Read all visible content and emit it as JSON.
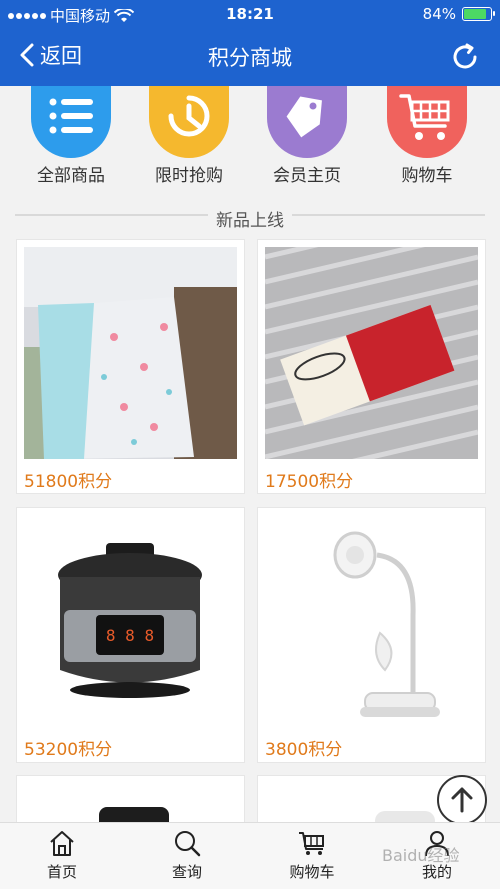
{
  "status_bar": {
    "carrier": "中国移动",
    "time": "18:21",
    "battery": "84%",
    "battery_level": 0.84
  },
  "nav": {
    "back_label": "返回",
    "title": "积分商城",
    "refresh_icon": "refresh-icon",
    "color": "#1e63cf"
  },
  "categories": [
    {
      "label": "全部商品",
      "icon": "list-icon",
      "color": "#2d9cec"
    },
    {
      "label": "限时抢购",
      "icon": "clock-icon",
      "color": "#f5b82e"
    },
    {
      "label": "会员主页",
      "icon": "tag-icon",
      "color": "#9b7bd0"
    },
    {
      "label": "购物车",
      "icon": "cart-icon",
      "color": "#f0625d"
    }
  ],
  "section": {
    "title": "新品上线"
  },
  "products": [
    {
      "price": "51800积分",
      "image": "blanket-photo"
    },
    {
      "price": "17500积分",
      "image": "cotton-label-photo"
    },
    {
      "price": "53200积分",
      "image": "rice-cooker-photo"
    },
    {
      "price": "3800积分",
      "image": "desk-lamp-fan-photo"
    }
  ],
  "tabs": [
    {
      "label": "首页",
      "icon": "home-icon"
    },
    {
      "label": "查询",
      "icon": "search-icon"
    },
    {
      "label": "购物车",
      "icon": "cart-icon"
    },
    {
      "label": "我的",
      "icon": "user-icon"
    }
  ],
  "watermark": "Baidu经验",
  "price_color": "#e07a1b"
}
